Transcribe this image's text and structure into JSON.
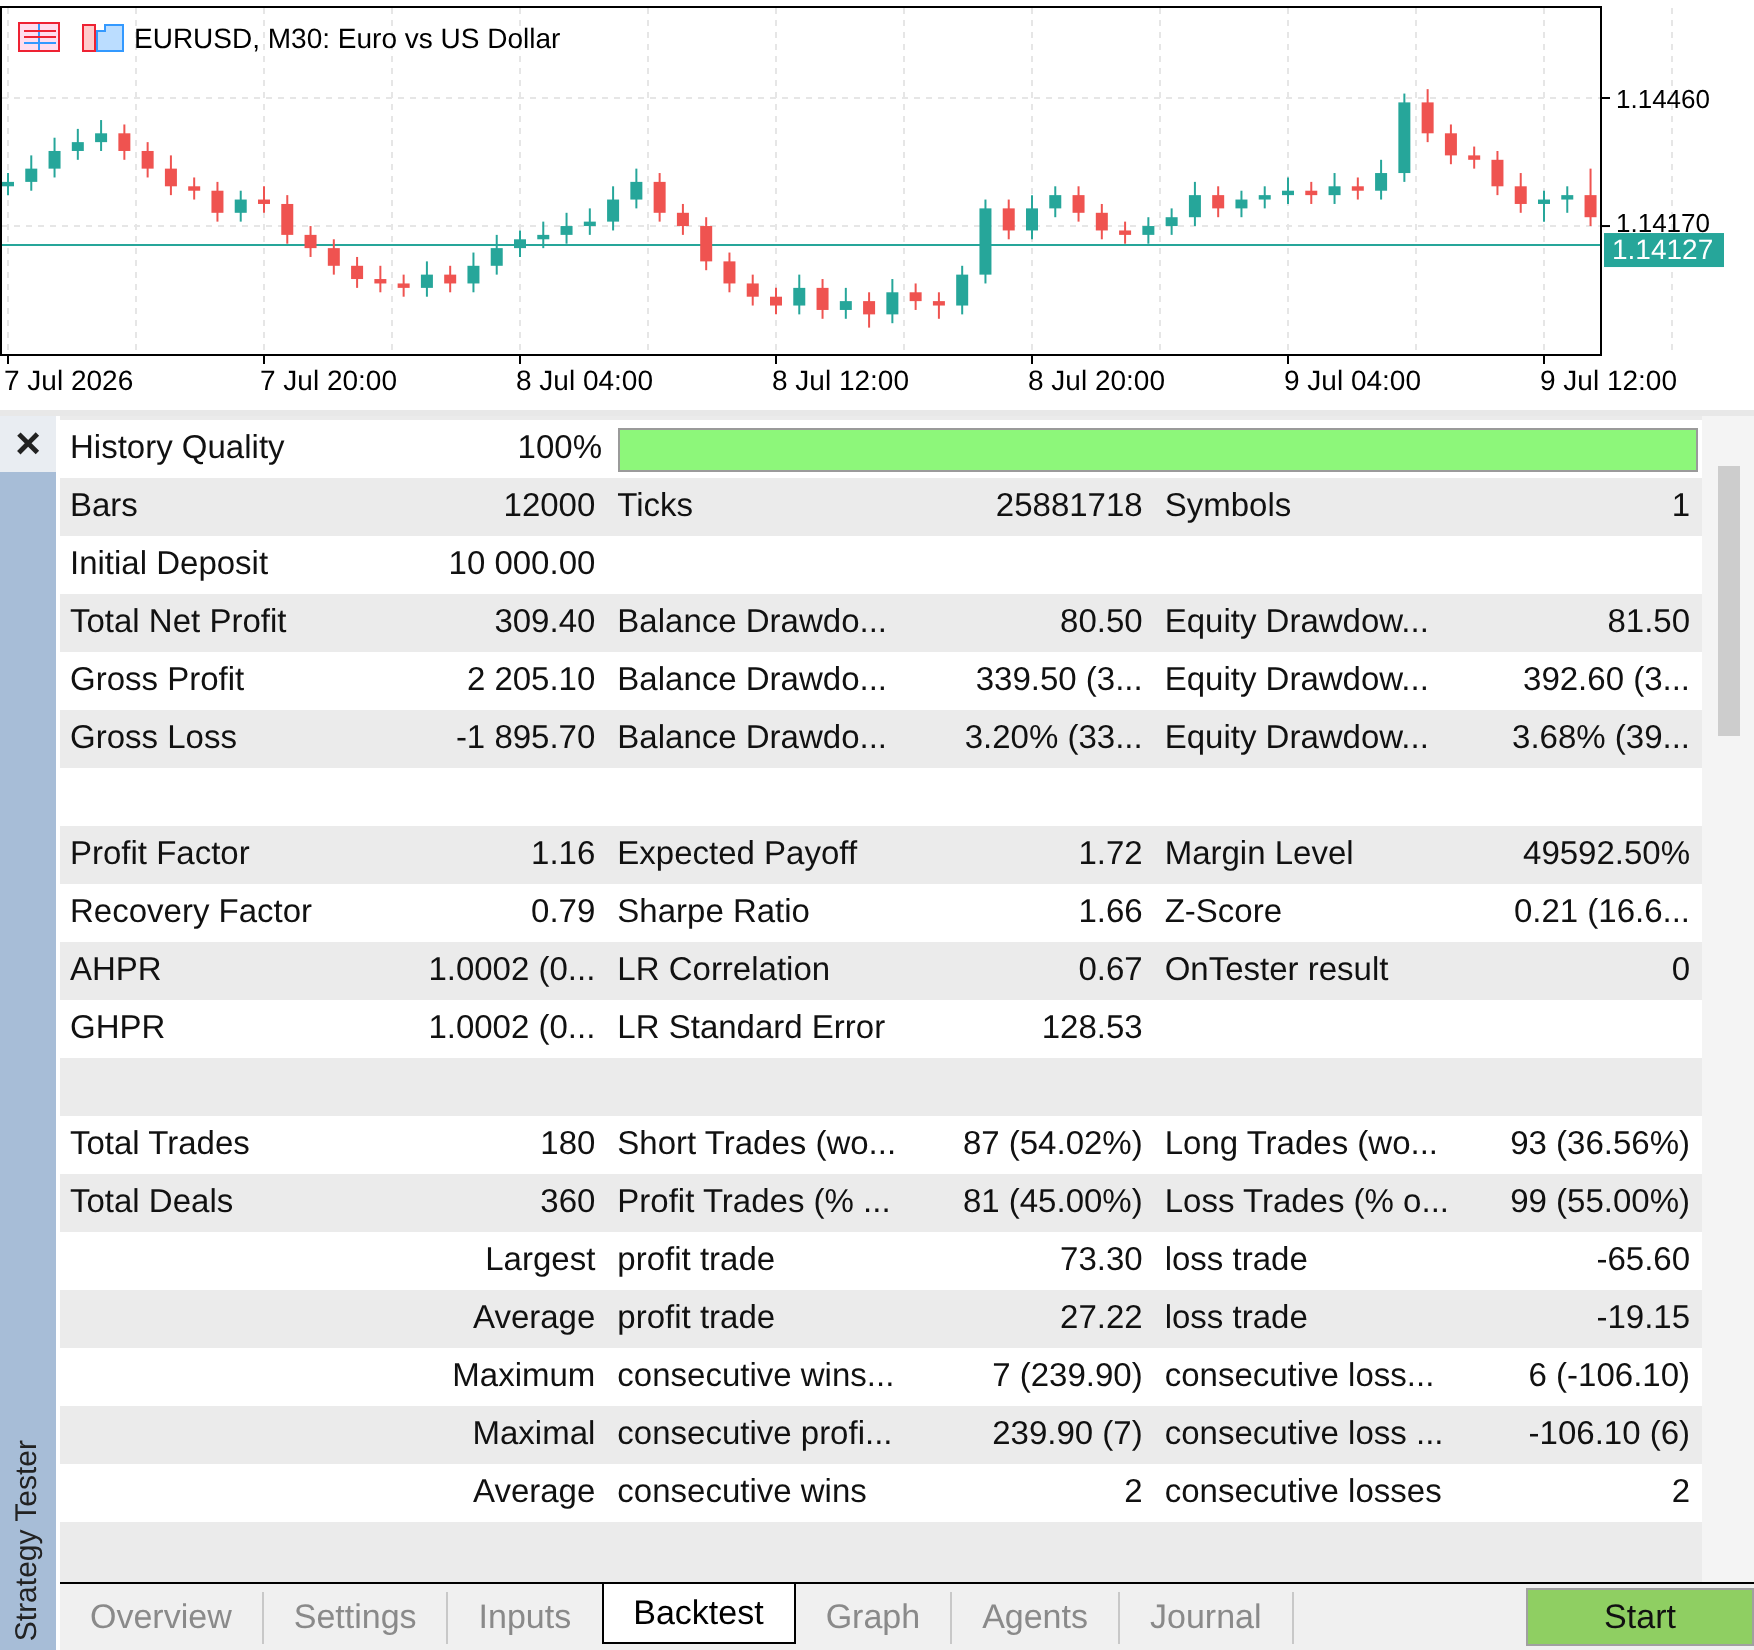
{
  "chart": {
    "title": "EURUSD, M30:  Euro vs US Dollar",
    "time_labels": [
      "7 Jul 2026",
      "7 Jul 20:00",
      "8 Jul 04:00",
      "8 Jul 12:00",
      "8 Jul 20:00",
      "9 Jul 04:00",
      "9 Jul 12:00"
    ],
    "chart_data": {
      "type": "candlestick",
      "grid": true,
      "ylim": [
        1.13878,
        1.14666
      ],
      "ref_lines": [
        {
          "axis": "y",
          "value": 1.14127,
          "label": "1.14127",
          "color": "#26a69a"
        }
      ],
      "yticks": [
        {
          "value": 1.1446,
          "label": "1.14460"
        },
        {
          "value": 1.1417,
          "label": "1.14170"
        }
      ],
      "ohlc": [
        [
          1.1426,
          1.1429,
          1.1424,
          1.1427
        ],
        [
          1.1427,
          1.1433,
          1.1425,
          1.143
        ],
        [
          1.143,
          1.1437,
          1.1428,
          1.1434
        ],
        [
          1.1434,
          1.1439,
          1.1432,
          1.1436
        ],
        [
          1.1436,
          1.1441,
          1.1434,
          1.1438
        ],
        [
          1.1438,
          1.144,
          1.1432,
          1.1434
        ],
        [
          1.1434,
          1.1436,
          1.1428,
          1.143
        ],
        [
          1.143,
          1.1433,
          1.1424,
          1.1426
        ],
        [
          1.1426,
          1.1428,
          1.1423,
          1.1425
        ],
        [
          1.1425,
          1.1427,
          1.1418,
          1.142
        ],
        [
          1.142,
          1.1425,
          1.1418,
          1.1423
        ],
        [
          1.1423,
          1.1426,
          1.142,
          1.1422
        ],
        [
          1.1422,
          1.1424,
          1.1413,
          1.1415
        ],
        [
          1.1415,
          1.1417,
          1.141,
          1.1412
        ],
        [
          1.1412,
          1.1414,
          1.1406,
          1.1408
        ],
        [
          1.1408,
          1.141,
          1.1403,
          1.1405
        ],
        [
          1.1405,
          1.1408,
          1.1402,
          1.1404
        ],
        [
          1.1404,
          1.1406,
          1.1401,
          1.1403
        ],
        [
          1.1403,
          1.1409,
          1.1401,
          1.1406
        ],
        [
          1.1406,
          1.1408,
          1.1402,
          1.1404
        ],
        [
          1.1404,
          1.1411,
          1.1402,
          1.1408
        ],
        [
          1.1408,
          1.1415,
          1.1406,
          1.1412
        ],
        [
          1.1412,
          1.1416,
          1.141,
          1.1414
        ],
        [
          1.1414,
          1.1418,
          1.1412,
          1.1415
        ],
        [
          1.1415,
          1.142,
          1.1413,
          1.1417
        ],
        [
          1.1417,
          1.1421,
          1.1415,
          1.1418
        ],
        [
          1.1418,
          1.1426,
          1.1416,
          1.1423
        ],
        [
          1.1423,
          1.143,
          1.1421,
          1.1427
        ],
        [
          1.1427,
          1.1429,
          1.1418,
          1.142
        ],
        [
          1.142,
          1.1422,
          1.1415,
          1.1417
        ],
        [
          1.1417,
          1.1419,
          1.1407,
          1.1409
        ],
        [
          1.1409,
          1.1411,
          1.1402,
          1.1404
        ],
        [
          1.1404,
          1.1406,
          1.1399,
          1.1401
        ],
        [
          1.1401,
          1.1403,
          1.1397,
          1.1399
        ],
        [
          1.1399,
          1.1406,
          1.1397,
          1.1403
        ],
        [
          1.1403,
          1.1405,
          1.1396,
          1.1398
        ],
        [
          1.1398,
          1.1403,
          1.1396,
          1.14
        ],
        [
          1.14,
          1.1402,
          1.1394,
          1.1397
        ],
        [
          1.1397,
          1.1405,
          1.1395,
          1.1402
        ],
        [
          1.1402,
          1.1404,
          1.1398,
          1.14
        ],
        [
          1.14,
          1.1402,
          1.1396,
          1.1399
        ],
        [
          1.1399,
          1.1408,
          1.1397,
          1.1406
        ],
        [
          1.1406,
          1.1423,
          1.1404,
          1.1421
        ],
        [
          1.1421,
          1.1423,
          1.1414,
          1.1416
        ],
        [
          1.1416,
          1.1424,
          1.1414,
          1.1421
        ],
        [
          1.1421,
          1.1426,
          1.1419,
          1.1424
        ],
        [
          1.1424,
          1.1426,
          1.1418,
          1.142
        ],
        [
          1.142,
          1.1422,
          1.1414,
          1.1416
        ],
        [
          1.1416,
          1.1418,
          1.1413,
          1.1415
        ],
        [
          1.1415,
          1.1419,
          1.1413,
          1.1417
        ],
        [
          1.1417,
          1.1421,
          1.1415,
          1.1419
        ],
        [
          1.1419,
          1.1427,
          1.1417,
          1.1424
        ],
        [
          1.1424,
          1.1426,
          1.1419,
          1.1421
        ],
        [
          1.1421,
          1.1425,
          1.1419,
          1.1423
        ],
        [
          1.1423,
          1.1426,
          1.1421,
          1.1424
        ],
        [
          1.1424,
          1.1428,
          1.1422,
          1.1425
        ],
        [
          1.1425,
          1.1427,
          1.1422,
          1.1424
        ],
        [
          1.1424,
          1.1429,
          1.1422,
          1.1426
        ],
        [
          1.1426,
          1.1428,
          1.1423,
          1.1425
        ],
        [
          1.1425,
          1.1432,
          1.1423,
          1.1429
        ],
        [
          1.1429,
          1.1447,
          1.1427,
          1.1445
        ],
        [
          1.1445,
          1.1448,
          1.1436,
          1.1438
        ],
        [
          1.1438,
          1.144,
          1.1431,
          1.1433
        ],
        [
          1.1433,
          1.1435,
          1.143,
          1.1432
        ],
        [
          1.1432,
          1.1434,
          1.1424,
          1.1426
        ],
        [
          1.1426,
          1.1429,
          1.142,
          1.1422
        ],
        [
          1.1422,
          1.1425,
          1.1418,
          1.1423
        ],
        [
          1.1423,
          1.1426,
          1.142,
          1.1424
        ],
        [
          1.1424,
          1.143,
          1.1417,
          1.1419
        ]
      ]
    }
  },
  "sidebar": {
    "close": "×",
    "title": "Strategy Tester"
  },
  "report": {
    "rows": [
      {
        "kind": "quality",
        "cells": [
          "History Quality",
          "100%"
        ],
        "level": 1
      },
      {
        "kind": "pair",
        "cells": [
          "Bars",
          "12000",
          "Ticks",
          "25881718",
          "Symbols",
          "1"
        ]
      },
      {
        "kind": "pair",
        "cells": [
          "Initial Deposit",
          "10 000.00"
        ]
      },
      {
        "kind": "pair",
        "cells": [
          "Total Net Profit",
          "309.40",
          "Balance Drawdo...",
          "80.50",
          "Equity Drawdow...",
          "81.50"
        ]
      },
      {
        "kind": "pair",
        "cells": [
          "Gross Profit",
          "2 205.10",
          "Balance Drawdo...",
          "339.50 (3...",
          "Equity Drawdow...",
          "392.60 (3..."
        ]
      },
      {
        "kind": "pair",
        "cells": [
          "Gross Loss",
          "-1 895.70",
          "Balance Drawdo...",
          "3.20% (33...",
          "Equity Drawdow...",
          "3.68% (39..."
        ]
      },
      {
        "kind": "spacer"
      },
      {
        "kind": "pair",
        "cells": [
          "Profit Factor",
          "1.16",
          "Expected Payoff",
          "1.72",
          "Margin Level",
          "49592.50%"
        ]
      },
      {
        "kind": "pair",
        "cells": [
          "Recovery Factor",
          "0.79",
          "Sharpe Ratio",
          "1.66",
          "Z-Score",
          "0.21 (16.6..."
        ]
      },
      {
        "kind": "pair",
        "cells": [
          "AHPR",
          "1.0002 (0...",
          "LR Correlation",
          "0.67",
          "OnTester result",
          "0"
        ]
      },
      {
        "kind": "pair",
        "cells": [
          "GHPR",
          "1.0002 (0...",
          "LR Standard Error",
          "128.53"
        ]
      },
      {
        "kind": "spacer"
      },
      {
        "kind": "pair",
        "cells": [
          "Total Trades",
          "180",
          "Short Trades (wo...",
          "87 (54.02%)",
          "Long Trades (wo...",
          "93 (36.56%)"
        ]
      },
      {
        "kind": "pair",
        "cells": [
          "Total Deals",
          "360",
          "Profit Trades (% ...",
          "81 (45.00%)",
          "Loss Trades (% o...",
          "99 (55.00%)"
        ]
      },
      {
        "kind": "pair",
        "cells": [
          "",
          "Largest",
          "profit trade",
          "73.30",
          "loss trade",
          "-65.60"
        ]
      },
      {
        "kind": "pair",
        "cells": [
          "",
          "Average",
          "profit trade",
          "27.22",
          "loss trade",
          "-19.15"
        ]
      },
      {
        "kind": "pair",
        "cells": [
          "",
          "Maximum",
          "consecutive wins...",
          "7 (239.90)",
          "consecutive loss...",
          "6 (-106.10)"
        ]
      },
      {
        "kind": "pair",
        "cells": [
          "",
          "Maximal",
          "consecutive profi...",
          "239.90 (7)",
          "consecutive loss ...",
          "-106.10 (6)"
        ]
      },
      {
        "kind": "pair",
        "cells": [
          "",
          "Average",
          "consecutive wins",
          "2",
          "consecutive losses",
          "2"
        ]
      }
    ]
  },
  "tabs": [
    {
      "label": "Overview",
      "selected": false
    },
    {
      "label": "Settings",
      "selected": false
    },
    {
      "label": "Inputs",
      "selected": false
    },
    {
      "label": "Backtest",
      "selected": true
    },
    {
      "label": "Graph",
      "selected": false
    },
    {
      "label": "Agents",
      "selected": false
    },
    {
      "label": "Journal",
      "selected": false
    }
  ],
  "start_button": "Start"
}
